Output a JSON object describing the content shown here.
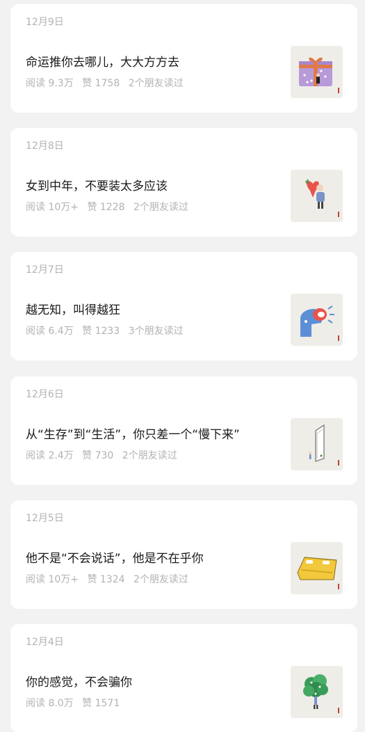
{
  "articles": [
    {
      "date": "12月9日",
      "title": "命运推你去哪儿，大大方方去",
      "reads": "阅读 9.3万",
      "likes": "赞 1758",
      "friends": "2个朋友读过",
      "thumbnail_icon": "gift-box-illustration"
    },
    {
      "date": "12月8日",
      "title": "女到中年，不要装太多应该",
      "reads": "阅读 10万+",
      "likes": "赞 1228",
      "friends": "2个朋友读过",
      "thumbnail_icon": "person-carrying-heart-illustration"
    },
    {
      "date": "12月7日",
      "title": "越无知，叫得越狂",
      "reads": "阅读 6.4万",
      "likes": "赞 1233",
      "friends": "3个朋友读过",
      "thumbnail_icon": "shouting-head-illustration"
    },
    {
      "date": "12月6日",
      "title": "从“生存”到“生活”，你只差一个“慢下来”",
      "reads": "阅读 2.4万",
      "likes": "赞 730",
      "friends": "2个朋友读过",
      "thumbnail_icon": "tall-door-illustration"
    },
    {
      "date": "12月5日",
      "title": "他不是“不会说话”，他是不在乎你",
      "reads": "阅读 10万+",
      "likes": "赞 1324",
      "friends": "2个朋友读过",
      "thumbnail_icon": "yellow-bed-illustration"
    },
    {
      "date": "12月4日",
      "title": "你的感觉，不会骗你",
      "reads": "阅读 8.0万",
      "likes": "赞 1571",
      "friends": "",
      "thumbnail_icon": "flower-bouquet-illustration"
    }
  ],
  "colors": {
    "background": "#f2f2f2",
    "card": "#ffffff",
    "title_text": "#1a1a1a",
    "secondary_text": "#b2b2b2"
  }
}
